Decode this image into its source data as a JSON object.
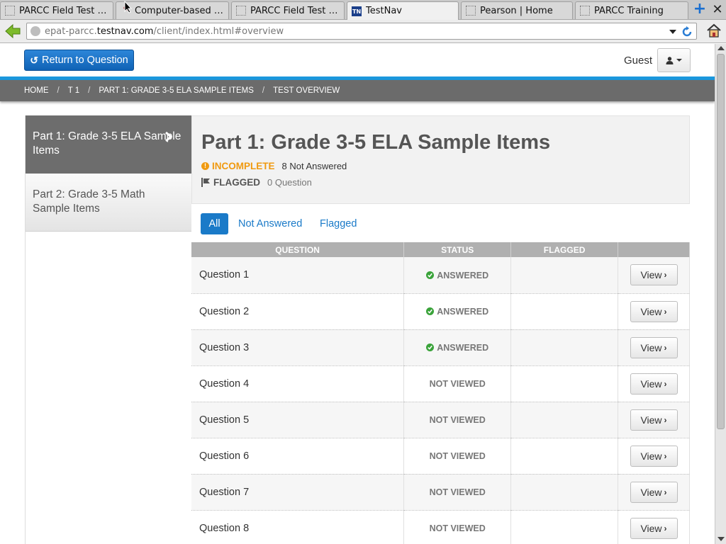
{
  "browser": {
    "tabs": [
      {
        "label": "PARCC Field Test …",
        "icon": "page-icon",
        "active": false
      },
      {
        "label": "Computer-based Sa…",
        "icon": "pdf-icon",
        "active": false
      },
      {
        "label": "PARCC Field Test …",
        "icon": "page-icon",
        "active": false
      },
      {
        "label": "TestNav",
        "icon": "testnav-icon",
        "active": true,
        "favicon_text": "TN"
      },
      {
        "label": "Pearson | Home",
        "icon": "page-icon",
        "active": false
      },
      {
        "label": "PARCC Training",
        "icon": "page-icon",
        "active": false
      }
    ],
    "url_prefix": "epat-parcc.",
    "url_domain": "testnav.com",
    "url_suffix": "/client/index.html#overview"
  },
  "header": {
    "return_label": "Return to Question",
    "user_label": "Guest"
  },
  "breadcrumb": [
    "HOME",
    "T 1",
    "PART 1: GRADE 3-5 ELA SAMPLE ITEMS",
    "TEST OVERVIEW"
  ],
  "sidebar": {
    "items": [
      {
        "label": "Part 1: Grade 3-5 ELA Sample Items",
        "active": true
      },
      {
        "label": "Part 2: Grade 3-5 Math Sample Items",
        "active": false
      }
    ]
  },
  "main": {
    "title": "Part 1: Grade 3-5 ELA Sample Items",
    "status_label": "INCOMPLETE",
    "not_answered_text": "8 Not Answered",
    "flagged_label": "FLAGGED",
    "flagged_count_text": "0 Question",
    "filters": {
      "all": "All",
      "not_answered": "Not Answered",
      "flagged": "Flagged"
    }
  },
  "table": {
    "headers": {
      "question": "QUESTION",
      "status": "STATUS",
      "flagged": "FLAGGED",
      "action": ""
    },
    "view_label": "View",
    "rows": [
      {
        "question": "Question 1",
        "status": "ANSWERED"
      },
      {
        "question": "Question 2",
        "status": "ANSWERED"
      },
      {
        "question": "Question 3",
        "status": "ANSWERED"
      },
      {
        "question": "Question 4",
        "status": "NOT VIEWED"
      },
      {
        "question": "Question 5",
        "status": "NOT VIEWED"
      },
      {
        "question": "Question 6",
        "status": "NOT VIEWED"
      },
      {
        "question": "Question 7",
        "status": "NOT VIEWED"
      },
      {
        "question": "Question 8",
        "status": "NOT VIEWED"
      }
    ]
  },
  "colors": {
    "accent_blue": "#1a7ac8",
    "incomplete_orange": "#f09a10",
    "answered_green": "#3aa33a",
    "breadcrumb_gray": "#6b6b6b"
  }
}
